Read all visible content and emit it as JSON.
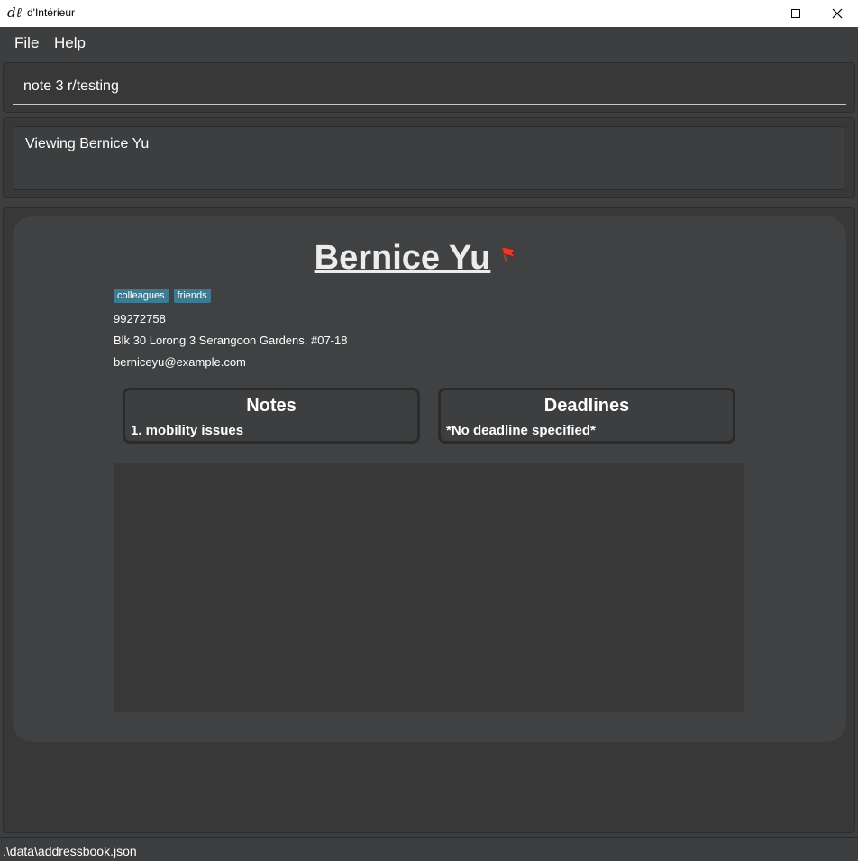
{
  "window": {
    "title": "d'Intérieur",
    "icon_glyph": "dℓ"
  },
  "menu": {
    "file_label": "File",
    "help_label": "Help"
  },
  "command": {
    "value": "note 3 r/testing"
  },
  "result": {
    "message": "Viewing Bernice Yu"
  },
  "person": {
    "name": "Bernice Yu",
    "flag_icon": "red-flag-icon",
    "tags": [
      "colleagues",
      "friends"
    ],
    "phone": "99272758",
    "address": "Blk 30 Lorong 3 Serangoon Gardens, #07-18",
    "email": "berniceyu@example.com",
    "notes": {
      "title": "Notes",
      "items": [
        "1. mobility issues"
      ]
    },
    "deadlines": {
      "title": "Deadlines",
      "items": [
        "*No deadline specified*"
      ]
    }
  },
  "status": {
    "path": ".\\data\\addressbook.json"
  },
  "colors": {
    "background": "#3c3e3f",
    "tag": "#3e7b91",
    "flag": "#e23c2e"
  }
}
